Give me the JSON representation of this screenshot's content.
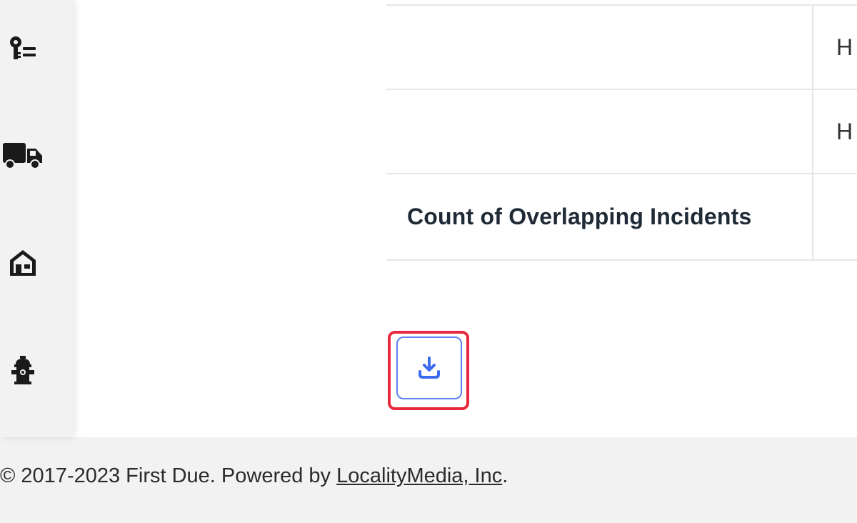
{
  "sidebar": {
    "items": [
      {
        "icon": "key-list-icon"
      },
      {
        "icon": "truck-icon"
      },
      {
        "icon": "building-icon"
      },
      {
        "icon": "hydrant-icon"
      }
    ]
  },
  "table": {
    "rows": [
      {
        "label": "",
        "value": "H"
      },
      {
        "label": "",
        "value": "H"
      },
      {
        "label": "Count of Overlapping Incidents",
        "value": ""
      }
    ]
  },
  "download": {
    "icon": "download-icon",
    "highlight_color": "#e8283c",
    "accent_color": "#3b6cf0"
  },
  "footer": {
    "prefix": "© 2017-2023 First Due. Powered by ",
    "link": "LocalityMedia, Inc",
    "suffix": "."
  }
}
